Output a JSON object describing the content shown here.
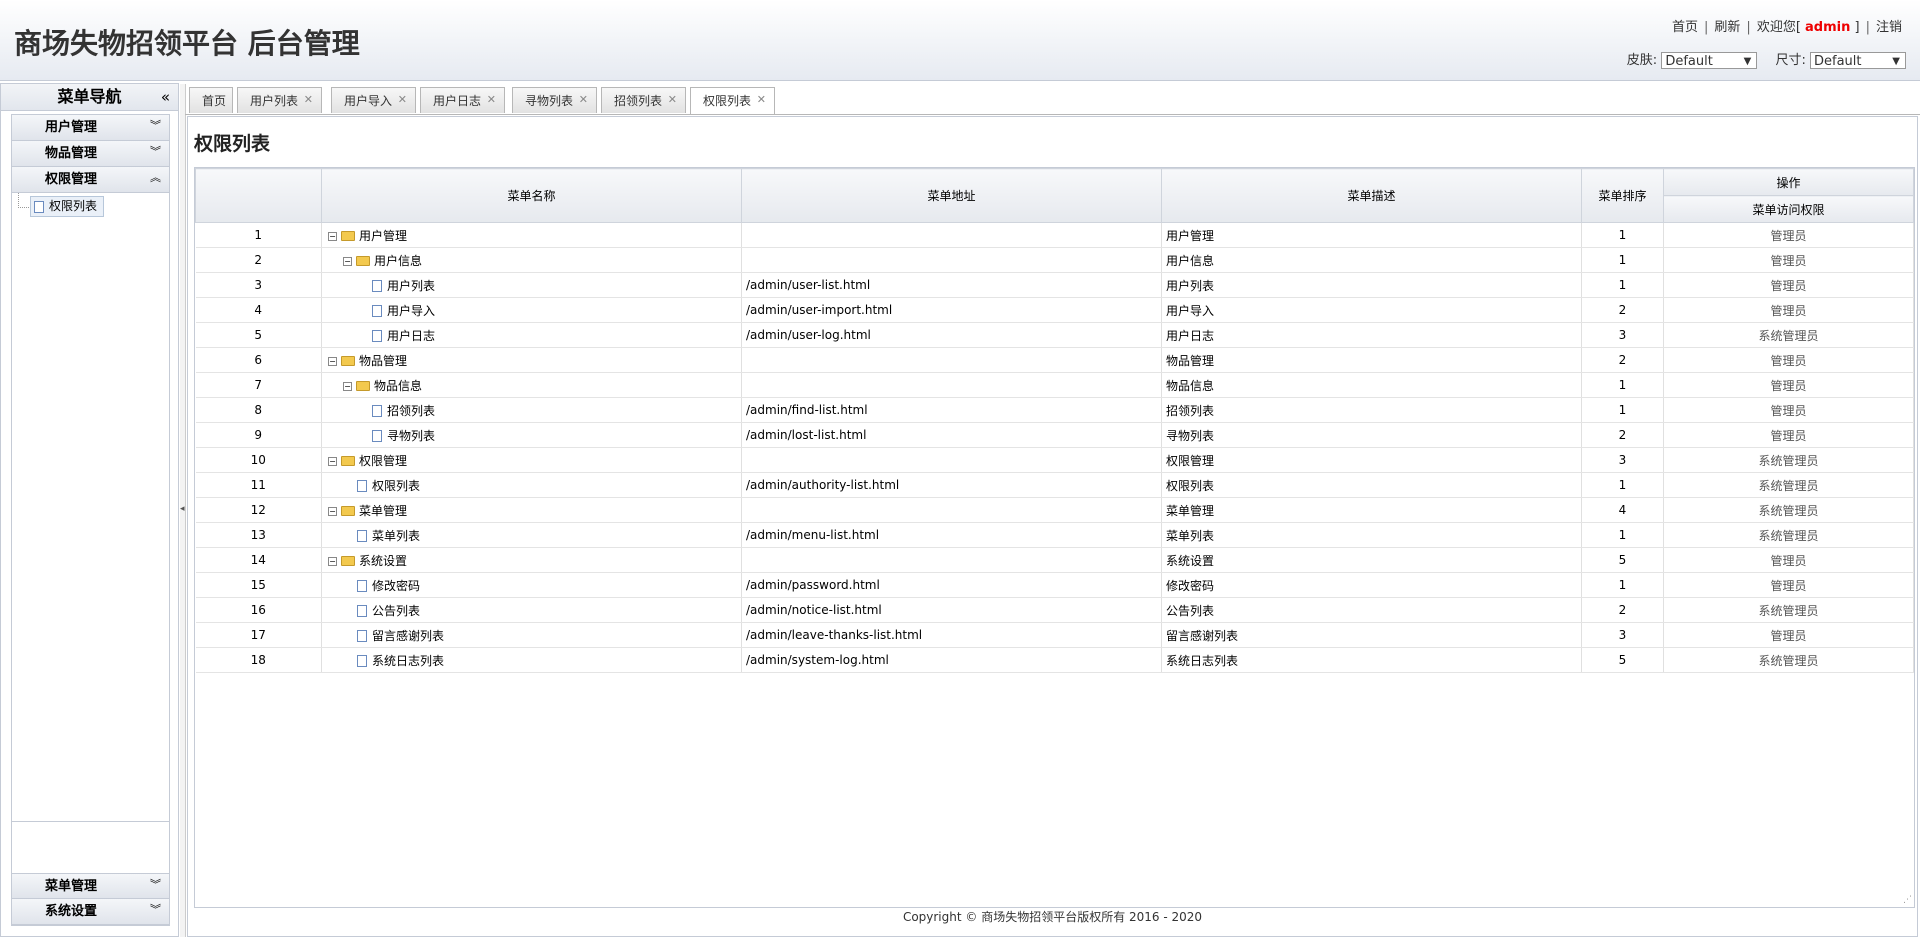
{
  "header": {
    "title": "商场失物招领平台 后台管理",
    "links": {
      "home": "首页",
      "refresh": "刷新",
      "welcome_prefix": "欢迎您[",
      "user": "admin",
      "welcome_suffix": "]",
      "logout": "注销"
    },
    "skin_label": "皮肤:",
    "skin_value": "Default",
    "size_label": "尺寸:",
    "size_value": "Default"
  },
  "sidebar": {
    "title": "菜单导航",
    "collapse_glyph": "«",
    "groups": [
      {
        "label": "用户管理",
        "chevron": "»"
      },
      {
        "label": "物品管理",
        "chevron": "»"
      },
      {
        "label": "权限管理",
        "chevron": "«"
      },
      {
        "label": "菜单管理",
        "chevron": "»"
      },
      {
        "label": "系统设置",
        "chevron": "»"
      }
    ],
    "active_item": "权限列表"
  },
  "tabs": [
    {
      "label": "首页",
      "closable": false
    },
    {
      "label": "用户列表",
      "closable": true
    },
    {
      "label": "用户导入",
      "closable": true
    },
    {
      "label": "用户日志",
      "closable": true
    },
    {
      "label": "寻物列表",
      "closable": true
    },
    {
      "label": "招领列表",
      "closable": true
    },
    {
      "label": "权限列表",
      "closable": true,
      "active": true
    }
  ],
  "page": {
    "title": "权限列表",
    "columns": {
      "name": "菜单名称",
      "url": "菜单地址",
      "desc": "菜单描述",
      "order": "菜单排序",
      "ops": "操作",
      "access": "菜单访问权限"
    },
    "rows": [
      {
        "no": "1",
        "level": 0,
        "type": "folder",
        "name": "用户管理",
        "url": "",
        "desc": "用户管理",
        "order": "1",
        "role": "管理员"
      },
      {
        "no": "2",
        "level": 1,
        "type": "folder",
        "name": "用户信息",
        "url": "",
        "desc": "用户信息",
        "order": "1",
        "role": "管理员"
      },
      {
        "no": "3",
        "level": 2,
        "type": "file",
        "name": "用户列表",
        "url": "/admin/user-list.html",
        "desc": "用户列表",
        "order": "1",
        "role": "管理员"
      },
      {
        "no": "4",
        "level": 2,
        "type": "file",
        "name": "用户导入",
        "url": "/admin/user-import.html",
        "desc": "用户导入",
        "order": "2",
        "role": "管理员"
      },
      {
        "no": "5",
        "level": 2,
        "type": "file",
        "name": "用户日志",
        "url": "/admin/user-log.html",
        "desc": "用户日志",
        "order": "3",
        "role": "系统管理员"
      },
      {
        "no": "6",
        "level": 0,
        "type": "folder",
        "name": "物品管理",
        "url": "",
        "desc": "物品管理",
        "order": "2",
        "role": "管理员"
      },
      {
        "no": "7",
        "level": 1,
        "type": "folder",
        "name": "物品信息",
        "url": "",
        "desc": "物品信息",
        "order": "1",
        "role": "管理员"
      },
      {
        "no": "8",
        "level": 2,
        "type": "file",
        "name": "招领列表",
        "url": "/admin/find-list.html",
        "desc": "招领列表",
        "order": "1",
        "role": "管理员"
      },
      {
        "no": "9",
        "level": 2,
        "type": "file",
        "name": "寻物列表",
        "url": "/admin/lost-list.html",
        "desc": "寻物列表",
        "order": "2",
        "role": "管理员"
      },
      {
        "no": "10",
        "level": 0,
        "type": "folder",
        "name": "权限管理",
        "url": "",
        "desc": "权限管理",
        "order": "3",
        "role": "系统管理员"
      },
      {
        "no": "11",
        "level": 1,
        "type": "file",
        "name": "权限列表",
        "url": "/admin/authority-list.html",
        "desc": "权限列表",
        "order": "1",
        "role": "系统管理员"
      },
      {
        "no": "12",
        "level": 0,
        "type": "folder",
        "name": "菜单管理",
        "url": "",
        "desc": "菜单管理",
        "order": "4",
        "role": "系统管理员"
      },
      {
        "no": "13",
        "level": 1,
        "type": "file",
        "name": "菜单列表",
        "url": "/admin/menu-list.html",
        "desc": "菜单列表",
        "order": "1",
        "role": "系统管理员"
      },
      {
        "no": "14",
        "level": 0,
        "type": "folder",
        "name": "系统设置",
        "url": "",
        "desc": "系统设置",
        "order": "5",
        "role": "管理员"
      },
      {
        "no": "15",
        "level": 1,
        "type": "file",
        "name": "修改密码",
        "url": "/admin/password.html",
        "desc": "修改密码",
        "order": "1",
        "role": "管理员"
      },
      {
        "no": "16",
        "level": 1,
        "type": "file",
        "name": "公告列表",
        "url": "/admin/notice-list.html",
        "desc": "公告列表",
        "order": "2",
        "role": "系统管理员"
      },
      {
        "no": "17",
        "level": 1,
        "type": "file",
        "name": "留言感谢列表",
        "url": "/admin/leave-thanks-list.html",
        "desc": "留言感谢列表",
        "order": "3",
        "role": "管理员"
      },
      {
        "no": "18",
        "level": 1,
        "type": "file",
        "name": "系统日志列表",
        "url": "/admin/system-log.html",
        "desc": "系统日志列表",
        "order": "5",
        "role": "系统管理员"
      }
    ]
  },
  "footer": {
    "text": "Copyright © 商场失物招领平台版权所有  2016 - 2020"
  },
  "colors": {
    "accent_user": "#ee0000",
    "border": "#c5cbd6"
  }
}
